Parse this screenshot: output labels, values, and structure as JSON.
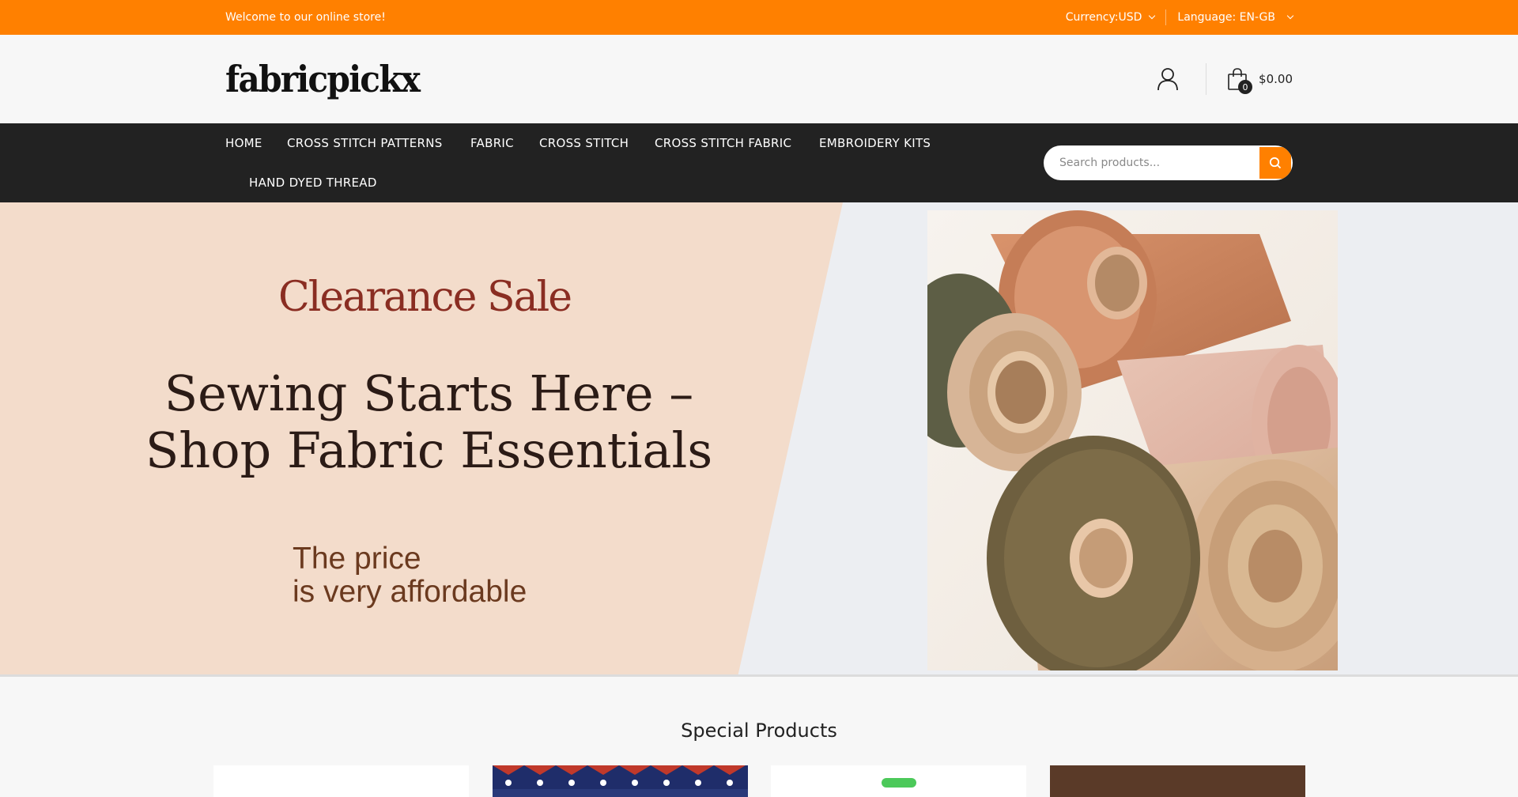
{
  "topbar": {
    "welcome": "Welcome to our online store!",
    "currency": "Currency:USD",
    "language": "Language: EN-GB",
    "bg_color": "#ff8000"
  },
  "header": {
    "logo": "fabricpickx",
    "user_icon": "user-icon",
    "cart_icon": "shopping-bag-icon",
    "cart_count": "0",
    "cart_total": "$0.00"
  },
  "nav": {
    "items": [
      {
        "label": "HOME"
      },
      {
        "label": "CROSS STITCH PATTERNS"
      },
      {
        "label": "FABRIC"
      },
      {
        "label": "CROSS STITCH"
      },
      {
        "label": "CROSS STITCH FABRIC"
      },
      {
        "label": "EMBROIDERY KITS"
      },
      {
        "label": "HAND DYED THREAD"
      }
    ],
    "search_placeholder": "Search products...",
    "search_icon": "search-icon",
    "accent": "#ff8000"
  },
  "banner": {
    "promo": "Clearance Sale",
    "headline_1": "Sewing Starts Here –",
    "headline_2": "Shop Fabric Essentials",
    "sub_1": "The price",
    "sub_2": "is very affordable",
    "image": "fabric-rolls-photo"
  },
  "specials": {
    "title": "Special Products"
  }
}
